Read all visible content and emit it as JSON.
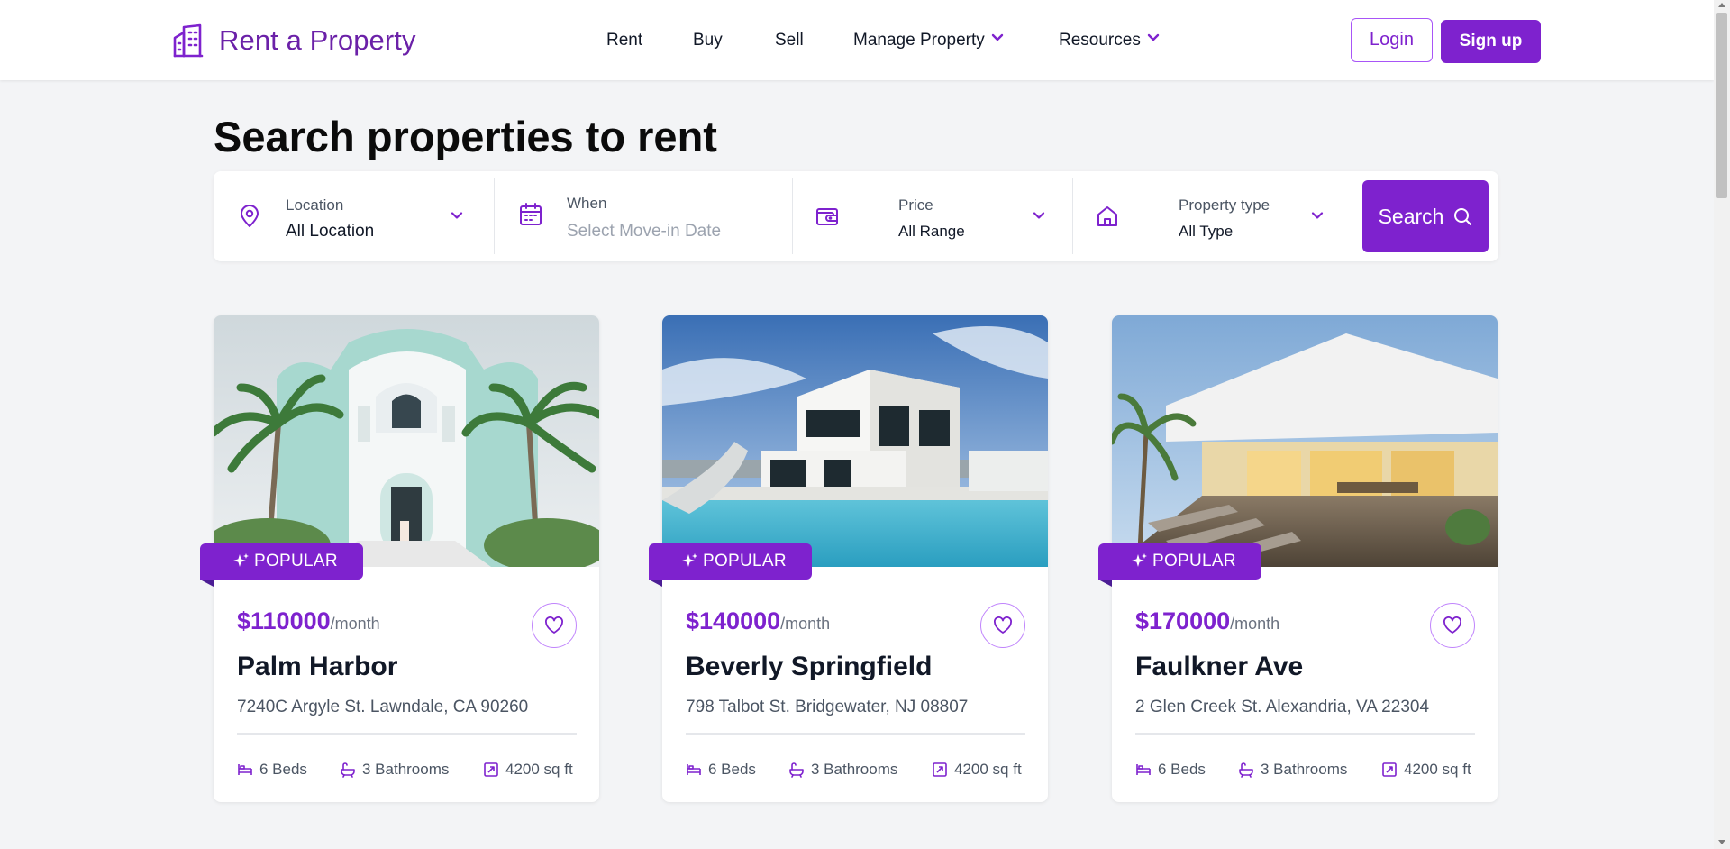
{
  "header": {
    "brand": "Rent a Property",
    "nav": {
      "rent": "Rent",
      "buy": "Buy",
      "sell": "Sell",
      "manage_property": "Manage Property",
      "resources": "Resources"
    },
    "login": "Login",
    "signup": "Sign up"
  },
  "search": {
    "title": "Search properties to rent",
    "location": {
      "label": "Location",
      "value": "All Location",
      "icon": "map-pin-icon"
    },
    "when": {
      "label": "When",
      "placeholder": "Select Move-in Date",
      "icon": "calendar-icon"
    },
    "price": {
      "label": "Price",
      "value": "All Range",
      "icon": "wallet-icon"
    },
    "property_type": {
      "label": "Property type",
      "value": "All Type",
      "icon": "home-icon"
    },
    "button": "Search"
  },
  "listings": [
    {
      "badge": "POPULAR",
      "price": "$110000",
      "per": "/month",
      "name": "Palm Harbor",
      "address": "7240C Argyle St. Lawndale, CA 90260",
      "beds": "6 Beds",
      "baths": "3 Bathrooms",
      "area": "4200 sq ft"
    },
    {
      "badge": "POPULAR",
      "price": "$140000",
      "per": "/month",
      "name": "Beverly Springfield",
      "address": "798 Talbot St. Bridgewater, NJ 08807",
      "beds": "6 Beds",
      "baths": "3 Bathrooms",
      "area": "4200 sq ft"
    },
    {
      "badge": "POPULAR",
      "price": "$170000",
      "per": "/month",
      "name": "Faulkner Ave",
      "address": "2 Glen Creek St. Alexandria, VA 22304",
      "beds": "6 Beds",
      "baths": "3 Bathrooms",
      "area": "4200 sq ft"
    }
  ],
  "colors": {
    "accent": "#7e22ce",
    "brand_text": "#6b21a8",
    "background": "#f3f4f6"
  }
}
